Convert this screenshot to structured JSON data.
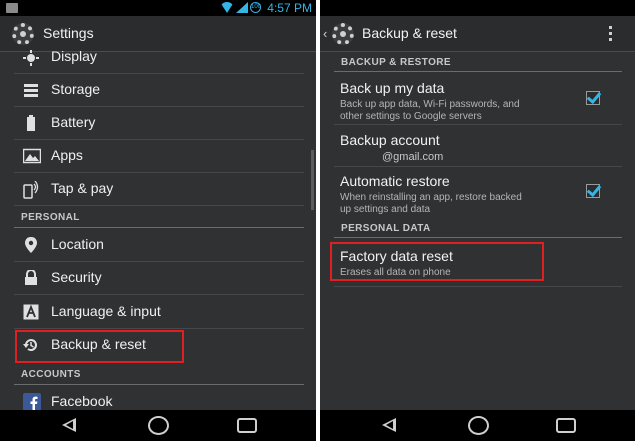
{
  "left": {
    "status": {
      "time": "4:57 PM",
      "battery": "100"
    },
    "title": "Settings",
    "items_top": [
      {
        "label": "Display",
        "icon": "display-icon"
      },
      {
        "label": "Storage",
        "icon": "storage-icon"
      },
      {
        "label": "Battery",
        "icon": "battery-icon"
      },
      {
        "label": "Apps",
        "icon": "apps-icon"
      },
      {
        "label": "Tap & pay",
        "icon": "tap-pay-icon"
      }
    ],
    "personal_header": "PERSONAL",
    "items_personal": [
      {
        "label": "Location",
        "icon": "location-icon"
      },
      {
        "label": "Security",
        "icon": "lock-icon"
      },
      {
        "label": "Language & input",
        "icon": "language-icon"
      },
      {
        "label": "Backup & reset",
        "icon": "backup-reset-icon"
      }
    ],
    "accounts_header": "ACCOUNTS",
    "items_accounts": [
      {
        "label": "Facebook",
        "icon": "facebook-icon"
      }
    ]
  },
  "right": {
    "title": "Backup & reset",
    "backup_header": "BACKUP & RESTORE",
    "backup_data": {
      "title": "Back up my data",
      "subtitle_line1": "Back up app data, Wi-Fi passwords, and",
      "subtitle_line2": "other settings to Google servers",
      "checked": true
    },
    "backup_account": {
      "title": "Backup account",
      "value": "@gmail.com"
    },
    "auto_restore": {
      "title": "Automatic restore",
      "subtitle_line1": "When reinstalling an app, restore backed",
      "subtitle_line2": "up settings and data",
      "checked": true
    },
    "personal_header": "PERSONAL DATA",
    "factory_reset": {
      "title": "Factory data reset",
      "subtitle": "Erases all data on phone"
    }
  },
  "colors": {
    "accent": "#33b5e5",
    "highlight": "#e02020",
    "background": "#2f3133"
  }
}
